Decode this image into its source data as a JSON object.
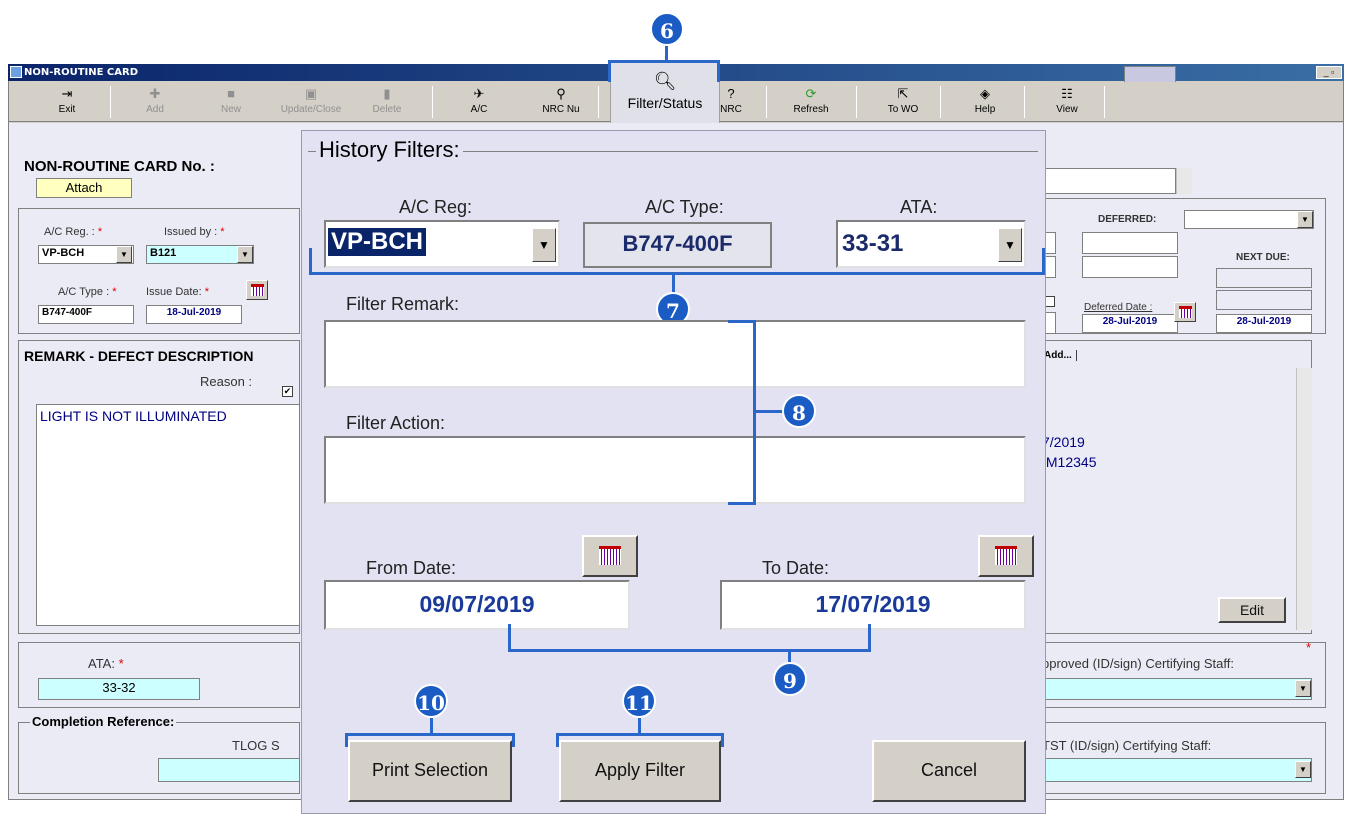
{
  "window": {
    "title": "NON-ROUTINE CARD"
  },
  "toolbar": {
    "exit": "Exit",
    "add": "Add",
    "new": "New",
    "update_close": "Update/Close",
    "delete": "Delete",
    "ac": "A/C",
    "nrc_nu": "NRC Nu",
    "filter_status": "Filter/Status",
    "nrc": "NRC",
    "refresh": "Refresh",
    "to_wo": "To WO",
    "help": "Help",
    "view": "View"
  },
  "card": {
    "title": "NON-ROUTINE CARD No. :",
    "attach": "Attach",
    "ac_reg_label": "A/C Reg. :",
    "ac_reg": "VP-BCH",
    "issued_by_label": "Issued by :",
    "issued_by": "B121",
    "ac_type_label": "A/C Type :",
    "ac_type": "B747-400F",
    "issue_date_label": "Issue Date:",
    "issue_date": "18-Jul-2019",
    "required": "*",
    "remark_header": "REMARK - DEFECT DESCRIPTION",
    "reason_label": "Reason :",
    "remark_text": "LIGHT IS NOT ILLUMINATED",
    "ata_label": "ATA:",
    "ata": "33-32",
    "completion_label": "Completion Reference:",
    "tlog_label": "TLOG S",
    "deferred_label": "DEFERRED:",
    "next_due_label": "NEXT DUE:",
    "deferred_date_label": "Deferred Date :",
    "deferred_date": "28-Jul-2019",
    "next_due_date": "28-Jul-2019",
    "tab_add": "Add...",
    "action_line1": "7/2019",
    "action_line2": "/M12345",
    "edit": "Edit",
    "approved_label": "pproved (ID/sign) Certifying Staff:",
    "tst_label": "TST (ID/sign) Certifying Staff:"
  },
  "dialog": {
    "title": "History Filters:",
    "ac_reg_label": "A/C Reg:",
    "ac_reg": "VP-BCH",
    "ac_type_label": "A/C Type:",
    "ac_type": "B747-400F",
    "ata_label": "ATA:",
    "ata": "33-31",
    "filter_remark_label": "Filter Remark:",
    "filter_remark": "",
    "filter_action_label": "Filter Action:",
    "filter_action": "",
    "from_date_label": "From Date:",
    "from_date": "09/07/2019",
    "to_date_label": "To Date:",
    "to_date": "17/07/2019",
    "print_selection": "Print Selection",
    "apply_filter": "Apply Filter",
    "cancel": "Cancel"
  },
  "callouts": {
    "c6": "6",
    "c7": "7",
    "c8": "8",
    "c9": "9",
    "c10": "10",
    "c11": "11"
  },
  "colors": {
    "callout": "#1a5bc4",
    "title_bar": "#0a246a",
    "dialog_bg": "#e2e2f2",
    "value_text": "#000080"
  }
}
